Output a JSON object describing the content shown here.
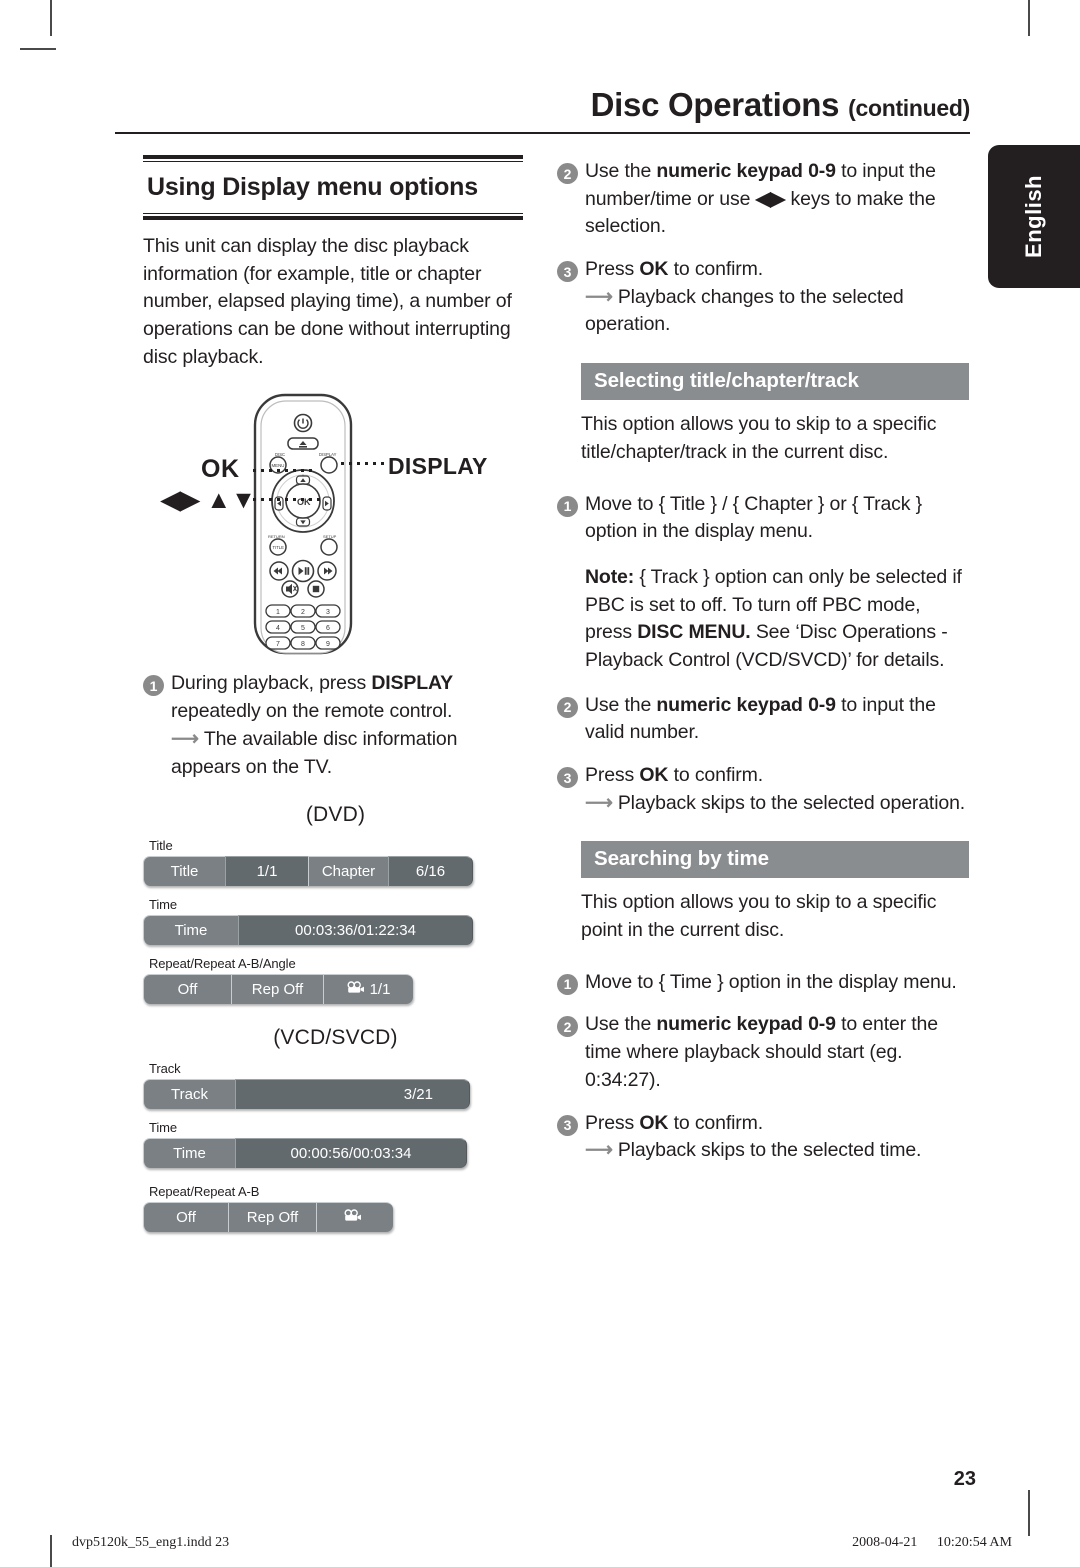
{
  "header": {
    "title": "Disc Operations",
    "title_suffix": "(continued)"
  },
  "language_tab": {
    "label": "English"
  },
  "left_column": {
    "section_title": "Using Display menu options",
    "intro": "This unit can display the disc playback information (for example, title or chapter number, elapsed playing time), a number of operations can be done without interrupting disc playback.",
    "remote_callouts": {
      "ok": "OK",
      "nav": "◀▶ ▲▼",
      "display": "DISPLAY"
    },
    "remote_buttons": {
      "power": "power-icon",
      "eject": "eject-icon",
      "disc_menu": "DISC MENU",
      "display": "DISPLAY",
      "ok": "OK",
      "return_title": "RETURN/TITLE",
      "setup": "SETUP",
      "prev": "prev-track-icon",
      "play_pause": "play-pause-icon",
      "next": "next-track-icon",
      "mute": "mute-icon",
      "stop": "stop-icon",
      "keypad": [
        "1",
        "2",
        "3",
        "4",
        "5",
        "6",
        "7",
        "8",
        "9"
      ]
    },
    "step1": {
      "num": "1",
      "text_pre": "During playback, press ",
      "text_bold": "DISPLAY",
      "text_post": " repeatedly on the remote control.",
      "result": "The available disc information appears on the TV."
    },
    "dvd_caption": "(DVD)",
    "dvd_osd": {
      "row1_label": "Title",
      "row1_segments": [
        "Title",
        "1/1",
        "Chapter",
        "6/16"
      ],
      "row2_label": "Time",
      "row2_segments": [
        "Time",
        "00:03:36/01:22:34"
      ],
      "row3_label": "Repeat/Repeat A-B/Angle",
      "row3_segments": [
        "Off",
        "Rep Off",
        "1/1"
      ],
      "row3_icon": "angle-camera-icon"
    },
    "vcd_caption": "(VCD/SVCD)",
    "vcd_osd": {
      "row1_label": "Track",
      "row1_segments": [
        "Track",
        "3/21"
      ],
      "row2_label": "Time",
      "row2_segments": [
        "Time",
        "00:00:56/00:03:34"
      ],
      "row3_label": "Repeat/Repeat A-B",
      "row3_segments": [
        "Off",
        "Rep Off",
        ""
      ],
      "row3_icon": "angle-camera-icon"
    }
  },
  "right_column": {
    "step2": {
      "num": "2",
      "pre": "Use the ",
      "bold": "numeric keypad 0-9",
      "mid": " to input the number/time or use ",
      "keys": "◀▶",
      "post": " keys to make the selection."
    },
    "step3": {
      "num": "3",
      "pre": "Press ",
      "bold": "OK",
      "post": " to confirm.",
      "result": "Playback changes to the selected operation."
    },
    "section_select": {
      "heading": "Selecting title/chapter/track",
      "intro": "This option allows you to skip to a specific title/chapter/track in the current disc.",
      "step1": {
        "num": "1",
        "text": "Move to { Title } / { Chapter } or { Track } option in the display menu."
      },
      "note_bold": "Note:",
      "note_part1": " { Track } option can only be selected if PBC is set to off. To turn off PBC mode, press ",
      "note_bold2": "DISC MENU.",
      "note_part2": " See ‘Disc Operations - Playback Control (VCD/SVCD)’ for details.",
      "step2": {
        "num": "2",
        "pre": "Use the ",
        "bold": "numeric keypad 0-9",
        "post": " to input the valid number."
      },
      "step3": {
        "num": "3",
        "pre": "Press ",
        "bold": "OK",
        "post": " to confirm.",
        "result": "Playback skips to the selected operation."
      }
    },
    "section_time": {
      "heading": "Searching by time",
      "intro": "This option allows you to skip to a specific point in the current disc.",
      "step1": {
        "num": "1",
        "text": "Move to { Time } option in the display menu."
      },
      "step2": {
        "num": "2",
        "pre": "Use the ",
        "bold": "numeric keypad 0-9",
        "post": " to enter the time where playback should start (eg. 0:34:27)."
      },
      "step3": {
        "num": "3",
        "pre": "Press ",
        "bold": "OK",
        "post": " to confirm.",
        "result": "Playback skips to the selected time."
      }
    }
  },
  "page_number": "23",
  "footer": {
    "file": "dvp5120k_55_eng1.indd   23",
    "date": "2008-04-21",
    "time": "10:20:54 AM"
  },
  "colors": {
    "ink": "#231f20",
    "step_circle": "#8a8a8a",
    "subsection_bar": "#8a8d90",
    "osd_light": "#7b8084",
    "osd_dark": "#636a6e"
  }
}
